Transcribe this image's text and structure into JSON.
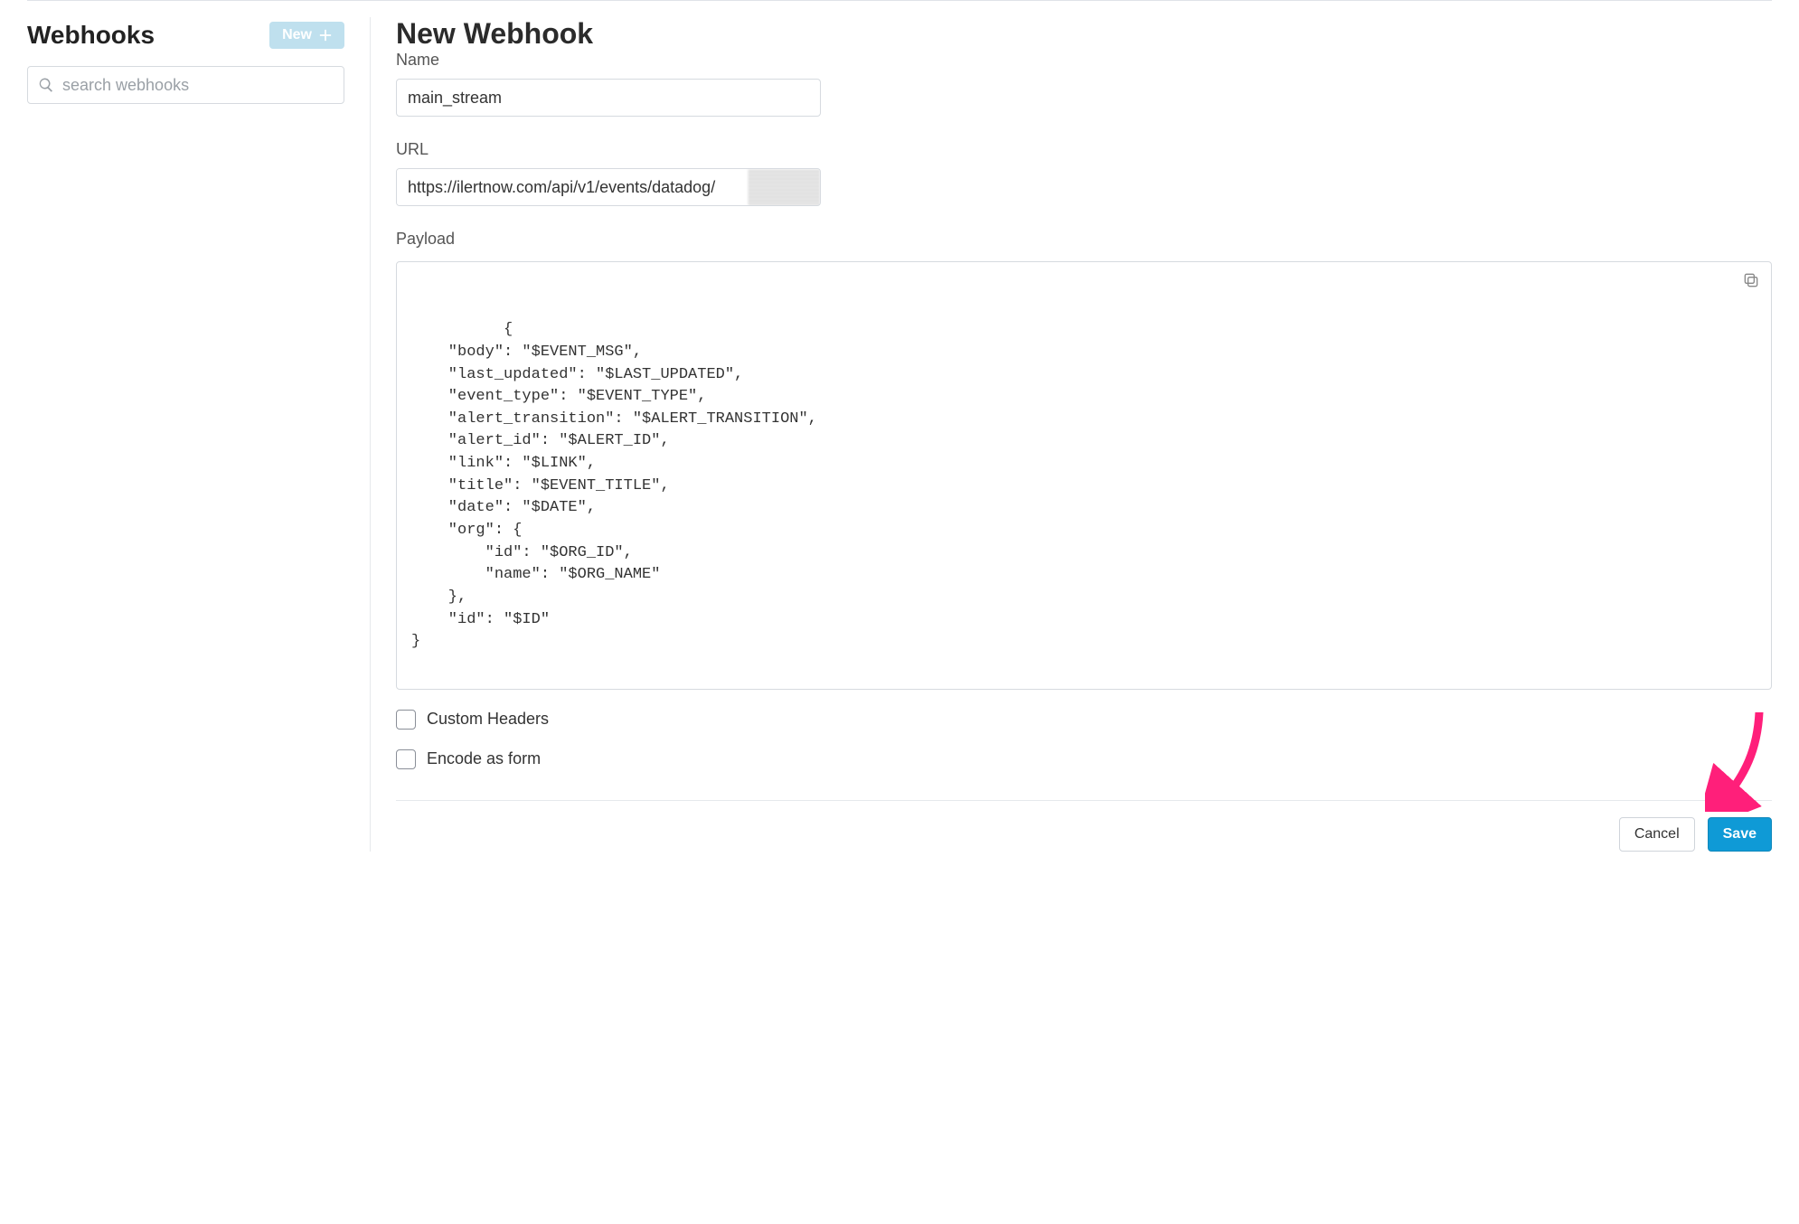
{
  "sidebar": {
    "title": "Webhooks",
    "new_button_label": "New",
    "search_placeholder": "search webhooks"
  },
  "form": {
    "title": "New Webhook",
    "name_label": "Name",
    "name_value": "main_stream",
    "url_label": "URL",
    "url_value": "https://ilertnow.com/api/v1/events/datadog/",
    "payload_label": "Payload",
    "payload_value": "{\n    \"body\": \"$EVENT_MSG\",\n    \"last_updated\": \"$LAST_UPDATED\",\n    \"event_type\": \"$EVENT_TYPE\",\n    \"alert_transition\": \"$ALERT_TRANSITION\",\n    \"alert_id\": \"$ALERT_ID\",\n    \"link\": \"$LINK\",\n    \"title\": \"$EVENT_TITLE\",\n    \"date\": \"$DATE\",\n    \"org\": {\n        \"id\": \"$ORG_ID\",\n        \"name\": \"$ORG_NAME\"\n    },\n    \"id\": \"$ID\"\n}",
    "custom_headers_label": "Custom Headers",
    "encode_as_form_label": "Encode as form",
    "cancel_label": "Cancel",
    "save_label": "Save"
  },
  "colors": {
    "accent": "#0f9ad6",
    "new_button_bg": "#bfe0ee",
    "annotation": "#ff1f7a"
  }
}
